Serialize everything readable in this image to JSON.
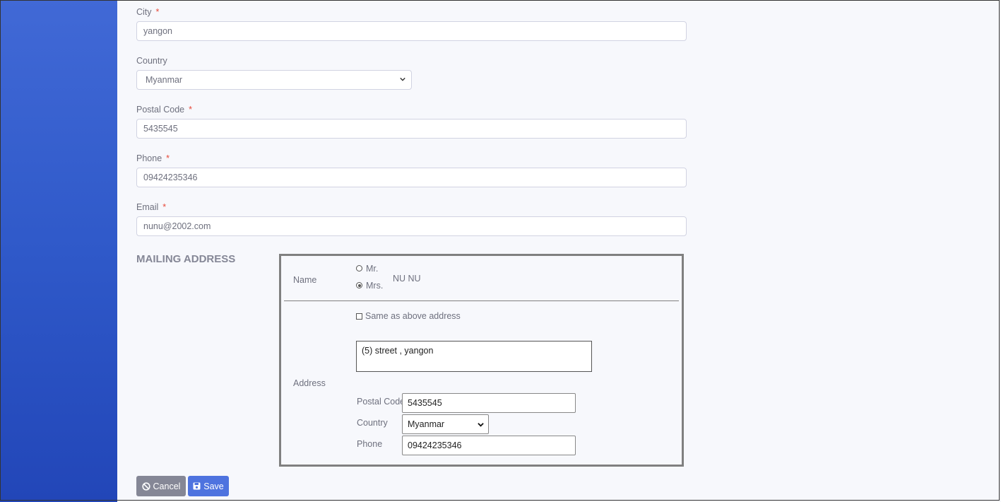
{
  "form": {
    "city": {
      "label": "City",
      "required": "*",
      "value": "yangon"
    },
    "country": {
      "label": "Country",
      "value": "Myanmar"
    },
    "postal_code": {
      "label": "Postal Code",
      "required": "*",
      "value": "5435545"
    },
    "phone": {
      "label": "Phone",
      "required": "*",
      "value": "09424235346"
    },
    "email": {
      "label": "Email",
      "required": "*",
      "value": "nunu@2002.com"
    }
  },
  "mailing": {
    "title": "MAILING ADDRESS",
    "name_label": "Name",
    "title_options": [
      "Mr.",
      "Mrs."
    ],
    "selected_title": "Mrs.",
    "name_value": "NU NU",
    "same_as_above": "Same as above address",
    "address_label": "Address",
    "address_value": "(5) street ,  yangon",
    "postal_code_label": "Postal Code",
    "postal_code_value": "5435545",
    "country_label": "Country",
    "country_value": "Myanmar",
    "phone_label": "Phone",
    "phone_value": "09424235346"
  },
  "actions": {
    "cancel": "Cancel",
    "save": "Save"
  },
  "colors": {
    "sidebar": "#3a62d1",
    "save": "#4e73df",
    "cancel": "#858796",
    "required": "#e74a3b"
  },
  "icons": {
    "cancel": "ban-icon",
    "save": "floppy-disk-icon"
  }
}
